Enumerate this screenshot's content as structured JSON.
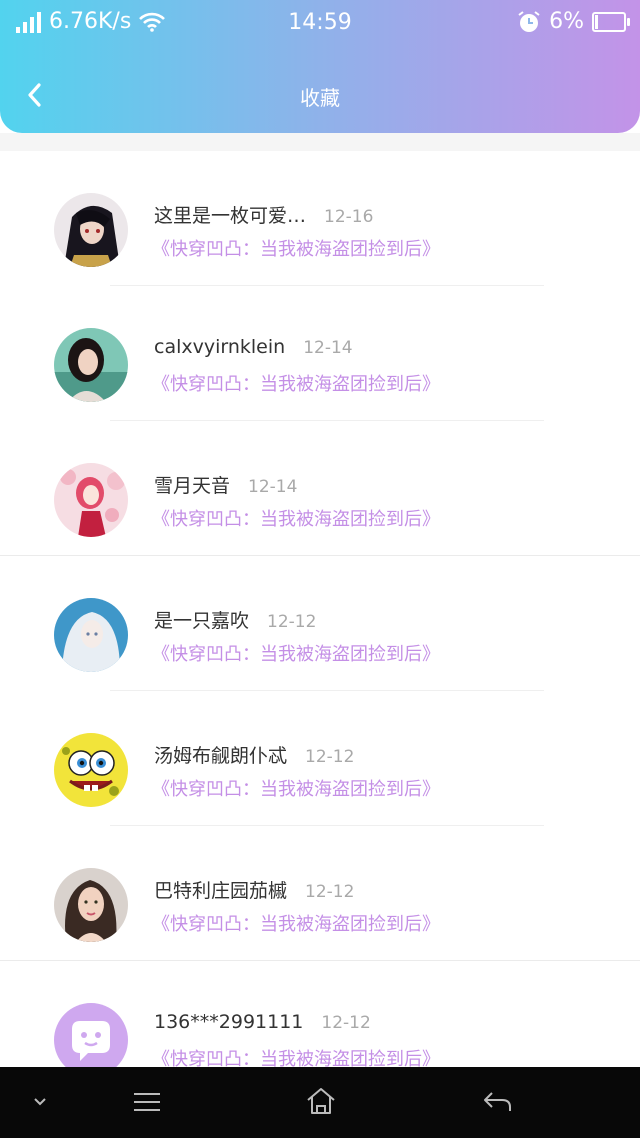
{
  "status": {
    "speed": "6.76K/s",
    "time": "14:59",
    "battery": "6%"
  },
  "header": {
    "title": "收藏"
  },
  "items": [
    {
      "name": "这里是一枚可爱…",
      "date": "12-16",
      "book": "《快穿凹凸：当我被海盗团捡到后》",
      "avatar": "anime-dark"
    },
    {
      "name": "calxvyirnklein",
      "date": "12-14",
      "book": "《快穿凹凸：当我被海盗团捡到后》",
      "avatar": "girl-photo"
    },
    {
      "name": "雪月天音",
      "date": "12-14",
      "book": "《快穿凹凸：当我被海盗团捡到后》",
      "avatar": "sakura"
    },
    {
      "name": "是一只嘉吹",
      "date": "12-12",
      "book": "《快穿凹凸：当我被海盗团捡到后》",
      "avatar": "white-hair"
    },
    {
      "name": "汤姆布觎朗仆忒",
      "date": "12-12",
      "book": "《快穿凹凸：当我被海盗团捡到后》",
      "avatar": "spongebob"
    },
    {
      "name": "巴特利庄园茄槭",
      "date": "12-12",
      "book": "《快穿凹凸：当我被海盗团捡到后》",
      "avatar": "woman-photo"
    },
    {
      "name": "136***2991111",
      "date": "12-12",
      "book": "《快穿凹凸：当我被海盗团捡到后》",
      "avatar": "default-chat"
    }
  ],
  "colors": {
    "accent": "#c48fe6",
    "header_start": "#52d3ee",
    "header_end": "#c393e8"
  }
}
